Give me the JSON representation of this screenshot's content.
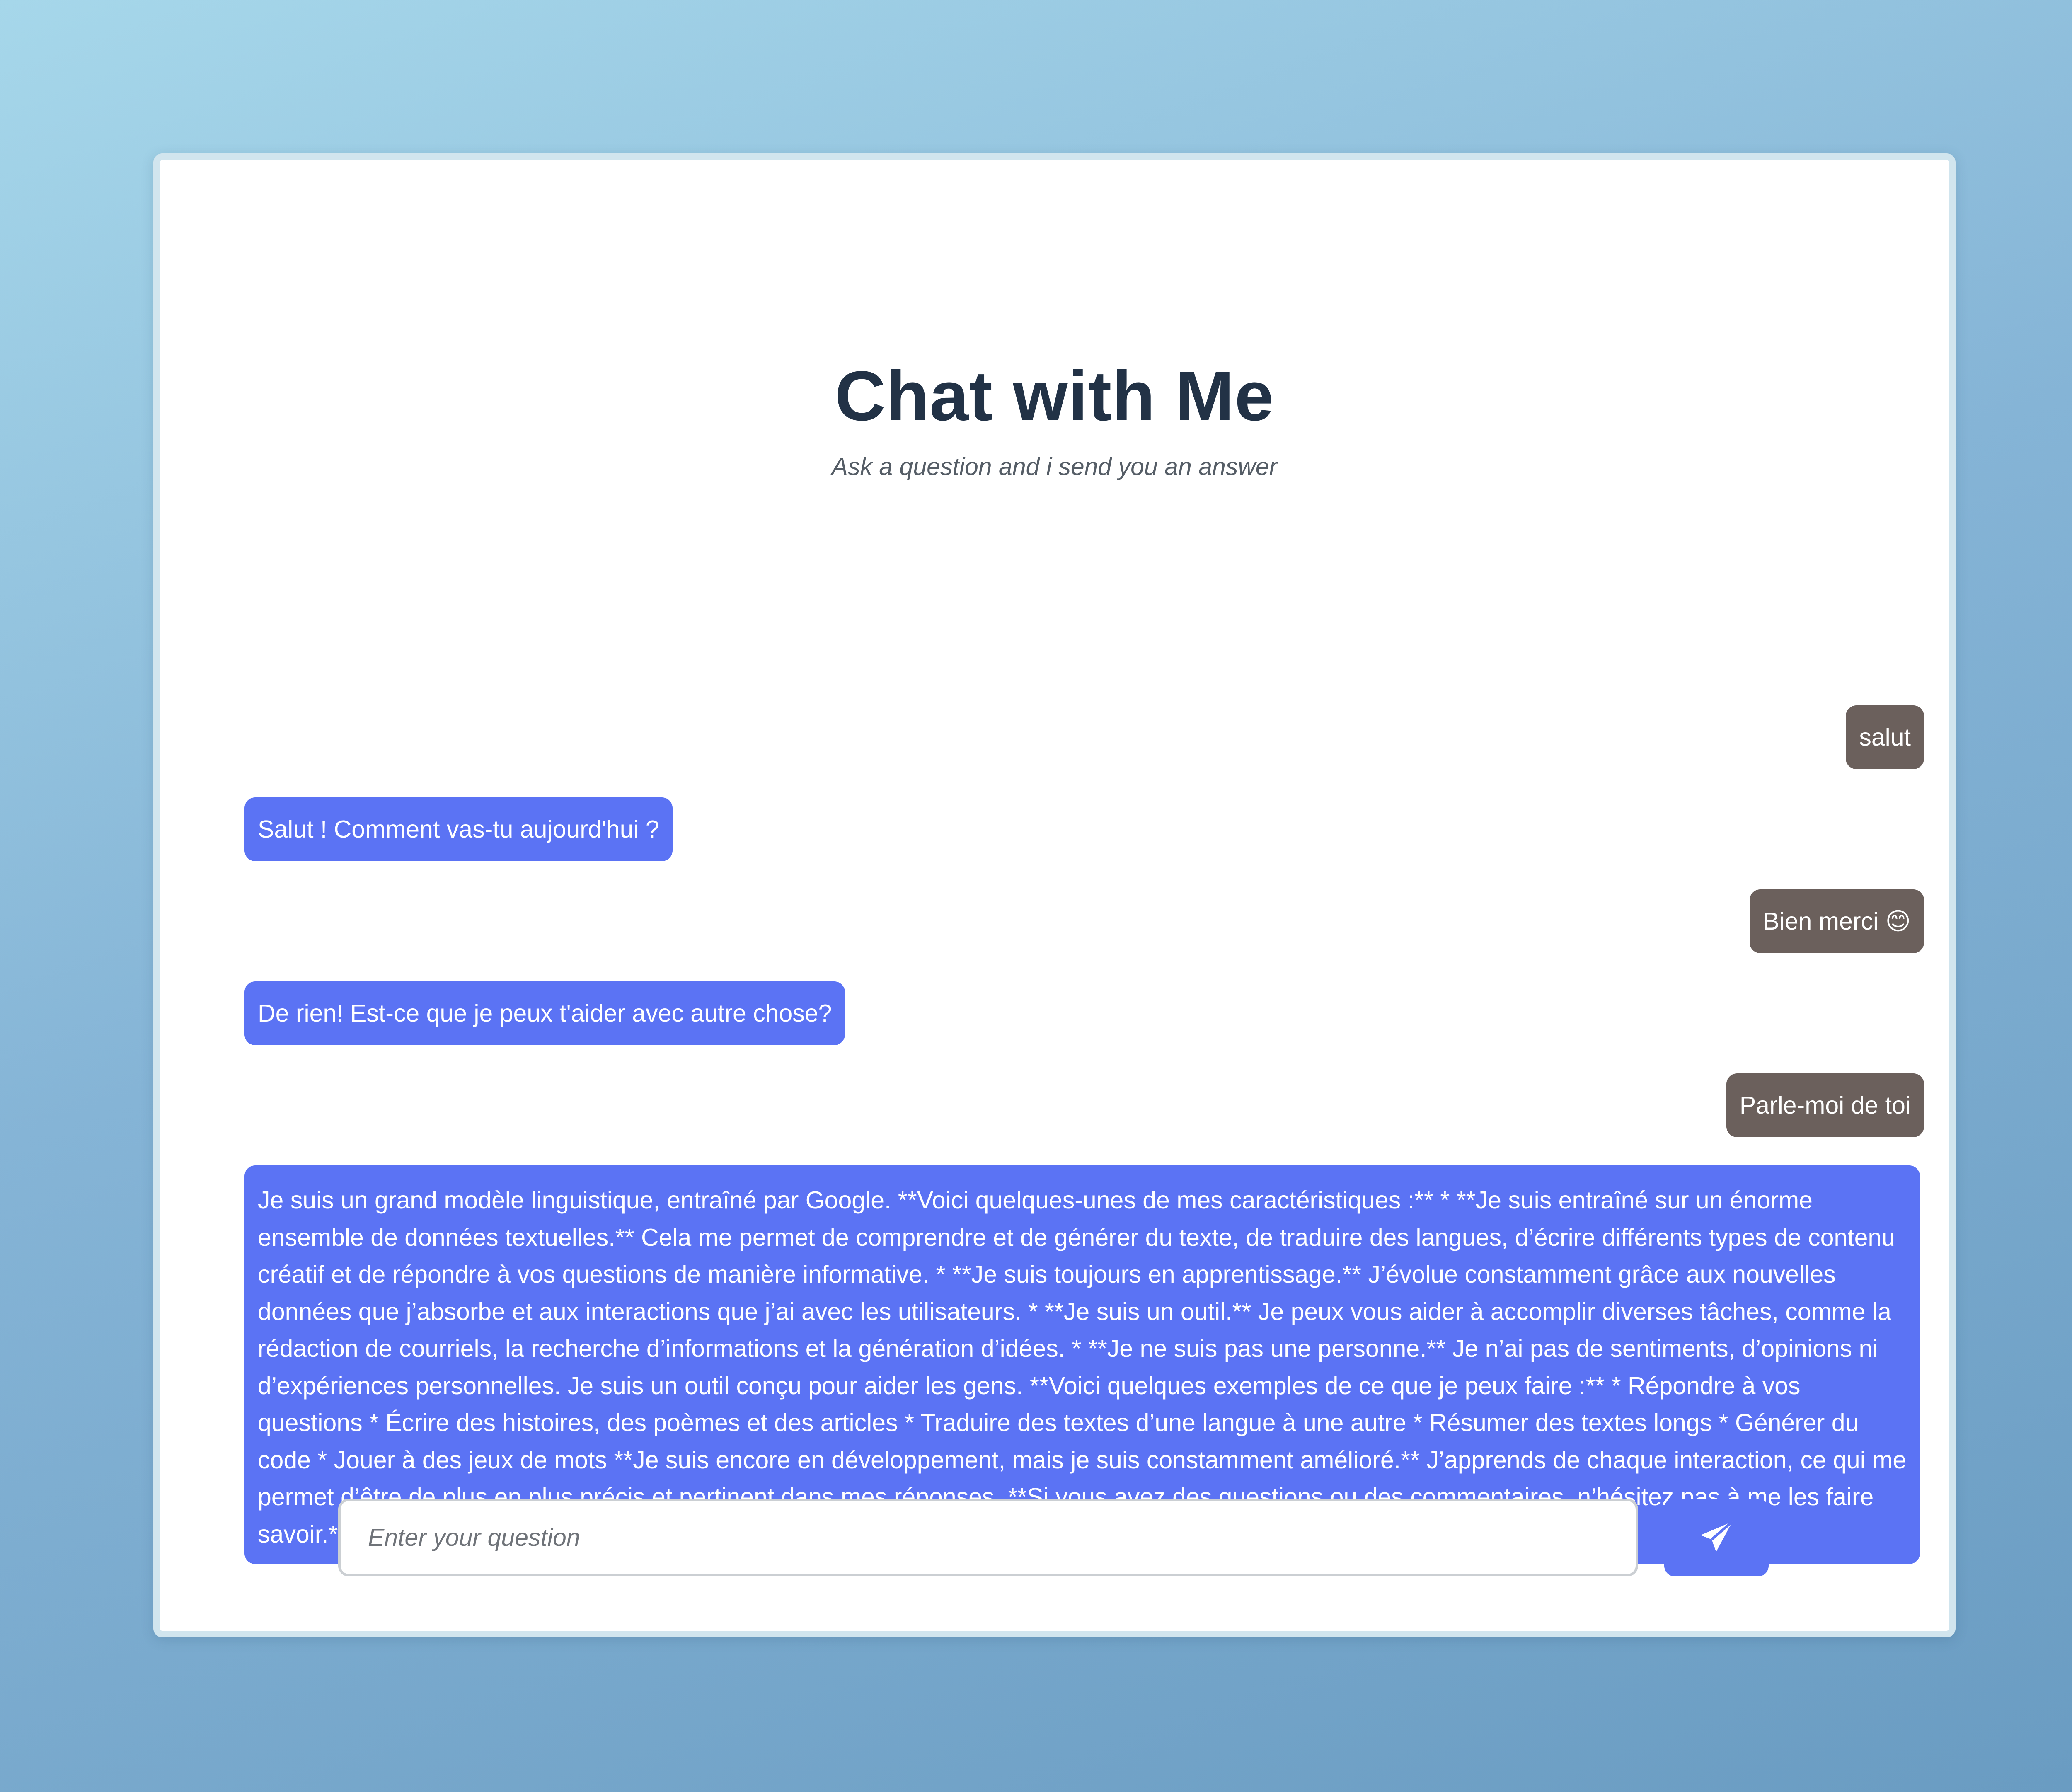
{
  "header": {
    "title": "Chat with Me",
    "subtitle": "Ask a question and i send you an answer"
  },
  "messages": [
    {
      "sender": "user",
      "text": "salut"
    },
    {
      "sender": "bot",
      "text": "Salut ! Comment vas-tu aujourd'hui ?"
    },
    {
      "sender": "user",
      "text": "Bien merci 😊"
    },
    {
      "sender": "bot",
      "text": "De rien! Est-ce que je peux t'aider avec autre chose?"
    },
    {
      "sender": "user",
      "text": "Parle-moi de toi"
    },
    {
      "sender": "bot",
      "text": "Je suis un grand modèle linguistique, entraîné par Google. **Voici quelques-unes de mes caractéristiques :** * **Je suis entraîné sur un énorme ensemble de données textuelles.** Cela me permet de comprendre et de générer du texte, de traduire des langues, d’écrire différents types de contenu créatif et de répondre à vos questions de manière informative. * **Je suis toujours en apprentissage.** J’évolue constamment grâce aux nouvelles données que j’absorbe et aux interactions que j’ai avec les utilisateurs. * **Je suis un outil.** Je peux vous aider à accomplir diverses tâches, comme la rédaction de courriels, la recherche d’informations et la génération d’idées. * **Je ne suis pas une personne.** Je n’ai pas de sentiments, d’opinions ni d’expériences personnelles. Je suis un outil conçu pour aider les gens. **Voici quelques exemples de ce que je peux faire :** * Répondre à vos questions * Écrire des histoires, des poèmes et des articles * Traduire des textes d’une langue à une autre * Résumer des textes longs * Générer du code * Jouer à des jeux de mots **Je suis encore en développement, mais je suis constamment amélioré.** J’apprends de chaque interaction, ce qui me permet d’être de plus en plus précis et pertinent dans mes réponses. **Si vous avez des questions ou des commentaires, n’hésitez pas à me les faire savoir.** J’apprécie vos commentaires et je suis toujours désireux d’apprendre de nouvelles choses."
    }
  ],
  "composer": {
    "placeholder": "Enter your question",
    "value": "",
    "send_icon": "paper-plane-icon"
  },
  "colors": {
    "user_bubble": "#6b605c",
    "bot_bubble": "#5b73f4",
    "send_button": "#5b73f4",
    "title": "#223246"
  }
}
